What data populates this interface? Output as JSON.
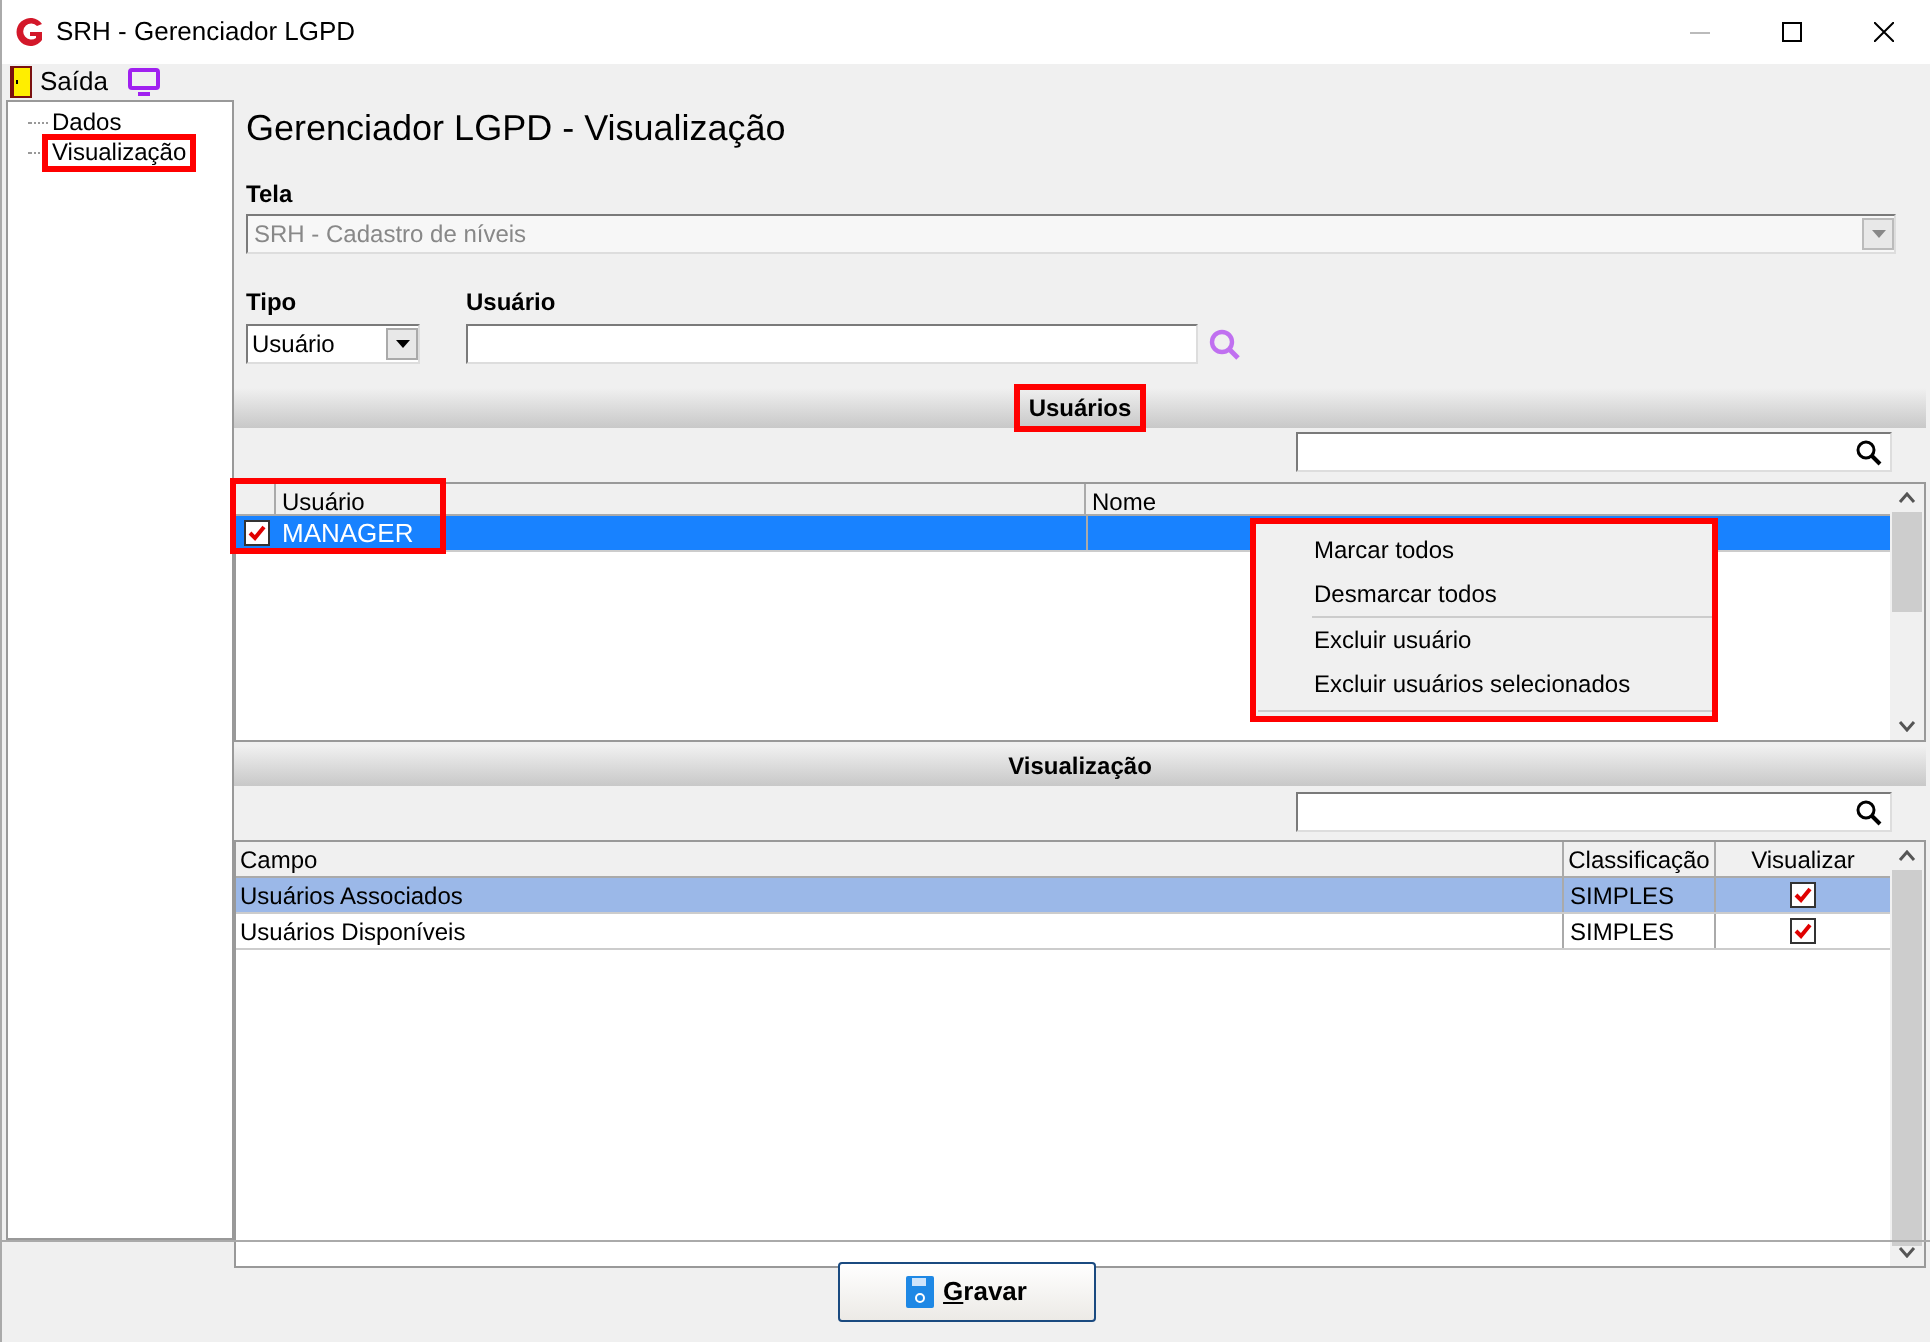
{
  "window": {
    "title": "SRH - Gerenciador LGPD"
  },
  "toolbar": {
    "exit_label": "Saída"
  },
  "tree": {
    "items": [
      {
        "label": "Dados",
        "annotated": false
      },
      {
        "label": "Visualização",
        "annotated": true
      }
    ]
  },
  "heading": "Gerenciador LGPD - Visualização",
  "tela": {
    "label": "Tela",
    "value": "SRH - Cadastro de níveis",
    "disabled": true
  },
  "tipo": {
    "label": "Tipo",
    "value": "Usuário"
  },
  "usuario": {
    "label": "Usuário"
  },
  "users_section": {
    "title": "Usuários",
    "annotated": true,
    "columns": [
      "Usuário",
      "Nome"
    ],
    "rows": [
      {
        "checked": true,
        "selected": true,
        "usuario": "MANAGER",
        "annotated": true
      }
    ]
  },
  "context_menu": {
    "annotated": true,
    "groups": [
      [
        "Marcar todos",
        "Desmarcar todos"
      ],
      [
        "Excluir usuário",
        "Excluir usuários selecionados"
      ]
    ]
  },
  "view_section": {
    "title": "Visualização",
    "columns": [
      "Campo",
      "Classificação",
      "Visualizar"
    ],
    "rows": [
      {
        "campo": "Usuários Associados",
        "classificacao": "SIMPLES",
        "visualizar": true,
        "selected": true
      },
      {
        "campo": "Usuários Disponíveis",
        "classificacao": "SIMPLES",
        "visualizar": true,
        "selected": false
      }
    ]
  },
  "save_button": {
    "label": "Gravar"
  }
}
